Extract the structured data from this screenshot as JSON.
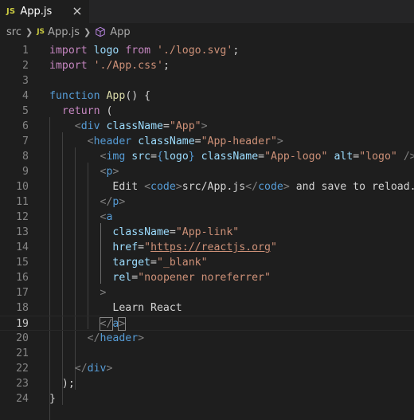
{
  "tab": {
    "badge": "JS",
    "label": "App.js",
    "close": "×"
  },
  "breadcrumb": {
    "folder": "src",
    "badge": "JS",
    "file": "App.js",
    "symbol": "App"
  },
  "editor": {
    "active_line": 19,
    "lines": [
      {
        "n": "1",
        "t": [
          [
            "kw",
            "import"
          ],
          [
            "txt",
            " "
          ],
          [
            "var",
            "logo"
          ],
          [
            "txt",
            " "
          ],
          [
            "kw",
            "from"
          ],
          [
            "txt",
            " "
          ],
          [
            "str",
            "'./logo.svg'"
          ],
          [
            "txt",
            ";"
          ]
        ]
      },
      {
        "n": "2",
        "t": [
          [
            "kw",
            "import"
          ],
          [
            "txt",
            " "
          ],
          [
            "str",
            "'./App.css'"
          ],
          [
            "txt",
            ";"
          ]
        ]
      },
      {
        "n": "3",
        "t": []
      },
      {
        "n": "4",
        "t": [
          [
            "kw2",
            "function"
          ],
          [
            "txt",
            " "
          ],
          [
            "fn",
            "App"
          ],
          [
            "txt",
            "() {"
          ]
        ]
      },
      {
        "n": "5",
        "t": [
          [
            "txt",
            "  "
          ],
          [
            "kw",
            "return"
          ],
          [
            "txt",
            " ("
          ]
        ]
      },
      {
        "n": "6",
        "t": [
          [
            "txt",
            "    "
          ],
          [
            "punct",
            "<"
          ],
          [
            "tag",
            "div"
          ],
          [
            "txt",
            " "
          ],
          [
            "var",
            "className"
          ],
          [
            "txt",
            "="
          ],
          [
            "str",
            "\"App\""
          ],
          [
            "punct",
            ">"
          ]
        ]
      },
      {
        "n": "7",
        "t": [
          [
            "txt",
            "      "
          ],
          [
            "punct",
            "<"
          ],
          [
            "tag",
            "header"
          ],
          [
            "txt",
            " "
          ],
          [
            "var",
            "className"
          ],
          [
            "txt",
            "="
          ],
          [
            "str",
            "\"App-header\""
          ],
          [
            "punct",
            ">"
          ]
        ]
      },
      {
        "n": "8",
        "t": [
          [
            "txt",
            "        "
          ],
          [
            "punct",
            "<"
          ],
          [
            "tag",
            "img"
          ],
          [
            "txt",
            " "
          ],
          [
            "var",
            "src"
          ],
          [
            "txt",
            "="
          ],
          [
            "kw2",
            "{"
          ],
          [
            "var",
            "logo"
          ],
          [
            "kw2",
            "}"
          ],
          [
            "txt",
            " "
          ],
          [
            "var",
            "className"
          ],
          [
            "txt",
            "="
          ],
          [
            "str",
            "\"App-logo\""
          ],
          [
            "txt",
            " "
          ],
          [
            "var",
            "alt"
          ],
          [
            "txt",
            "="
          ],
          [
            "str",
            "\"logo\""
          ],
          [
            "txt",
            " "
          ],
          [
            "punct",
            "/>"
          ]
        ]
      },
      {
        "n": "9",
        "t": [
          [
            "txt",
            "        "
          ],
          [
            "punct",
            "<"
          ],
          [
            "tag",
            "p"
          ],
          [
            "punct",
            ">"
          ]
        ]
      },
      {
        "n": "10",
        "t": [
          [
            "txt",
            "          Edit "
          ],
          [
            "punct",
            "<"
          ],
          [
            "tag",
            "code"
          ],
          [
            "punct",
            ">"
          ],
          [
            "txt",
            "src/App.js"
          ],
          [
            "punct",
            "</"
          ],
          [
            "tag",
            "code"
          ],
          [
            "punct",
            ">"
          ],
          [
            "txt",
            " and save to reload."
          ]
        ]
      },
      {
        "n": "11",
        "t": [
          [
            "txt",
            "        "
          ],
          [
            "punct",
            "</"
          ],
          [
            "tag",
            "p"
          ],
          [
            "punct",
            ">"
          ]
        ]
      },
      {
        "n": "12",
        "t": [
          [
            "txt",
            "        "
          ],
          [
            "punct",
            "<"
          ],
          [
            "tag",
            "a"
          ]
        ]
      },
      {
        "n": "13",
        "t": [
          [
            "txt",
            "          "
          ],
          [
            "var",
            "className"
          ],
          [
            "txt",
            "="
          ],
          [
            "str",
            "\"App-link\""
          ]
        ]
      },
      {
        "n": "14",
        "t": [
          [
            "txt",
            "          "
          ],
          [
            "var",
            "href"
          ],
          [
            "txt",
            "="
          ],
          [
            "str",
            "\""
          ],
          [
            "url",
            "https://reactjs.org"
          ],
          [
            "str",
            "\""
          ]
        ]
      },
      {
        "n": "15",
        "t": [
          [
            "txt",
            "          "
          ],
          [
            "var",
            "target"
          ],
          [
            "txt",
            "="
          ],
          [
            "str",
            "\"_blank\""
          ]
        ]
      },
      {
        "n": "16",
        "t": [
          [
            "txt",
            "          "
          ],
          [
            "var",
            "rel"
          ],
          [
            "txt",
            "="
          ],
          [
            "str",
            "\"noopener noreferrer\""
          ]
        ]
      },
      {
        "n": "17",
        "t": [
          [
            "txt",
            "        "
          ],
          [
            "punct",
            ">"
          ]
        ]
      },
      {
        "n": "18",
        "t": [
          [
            "txt",
            "          Learn React"
          ]
        ]
      },
      {
        "n": "19",
        "t": [
          [
            "txt",
            "        "
          ],
          [
            "punct",
            "</"
          ],
          [
            "tag",
            "a"
          ],
          [
            "punct",
            ">"
          ]
        ]
      },
      {
        "n": "20",
        "t": [
          [
            "txt",
            "      "
          ],
          [
            "punct",
            "</"
          ],
          [
            "tag",
            "header"
          ],
          [
            "punct",
            ">"
          ]
        ]
      },
      {
        "n": "21",
        "t": []
      },
      {
        "n": "22",
        "t": [
          [
            "txt",
            "    "
          ],
          [
            "punct",
            "</"
          ],
          [
            "tag",
            "div"
          ],
          [
            "punct",
            ">"
          ]
        ]
      },
      {
        "n": "23",
        "t": [
          [
            "txt",
            "  );"
          ]
        ]
      },
      {
        "n": "24",
        "t": [
          [
            "txt",
            "}"
          ]
        ]
      }
    ]
  },
  "colors": {
    "background": "#1e1e1e",
    "keyword_control": "#c586c0",
    "keyword_storage": "#569cd6",
    "function": "#dcdcaa",
    "variable": "#9cdcfe",
    "string": "#ce9178",
    "tag": "#569cd6",
    "js_badge": "#cbcb41"
  },
  "icons": {
    "file": "js-file-icon",
    "symbol": "cube-icon",
    "separator": "chevron-right-icon"
  }
}
